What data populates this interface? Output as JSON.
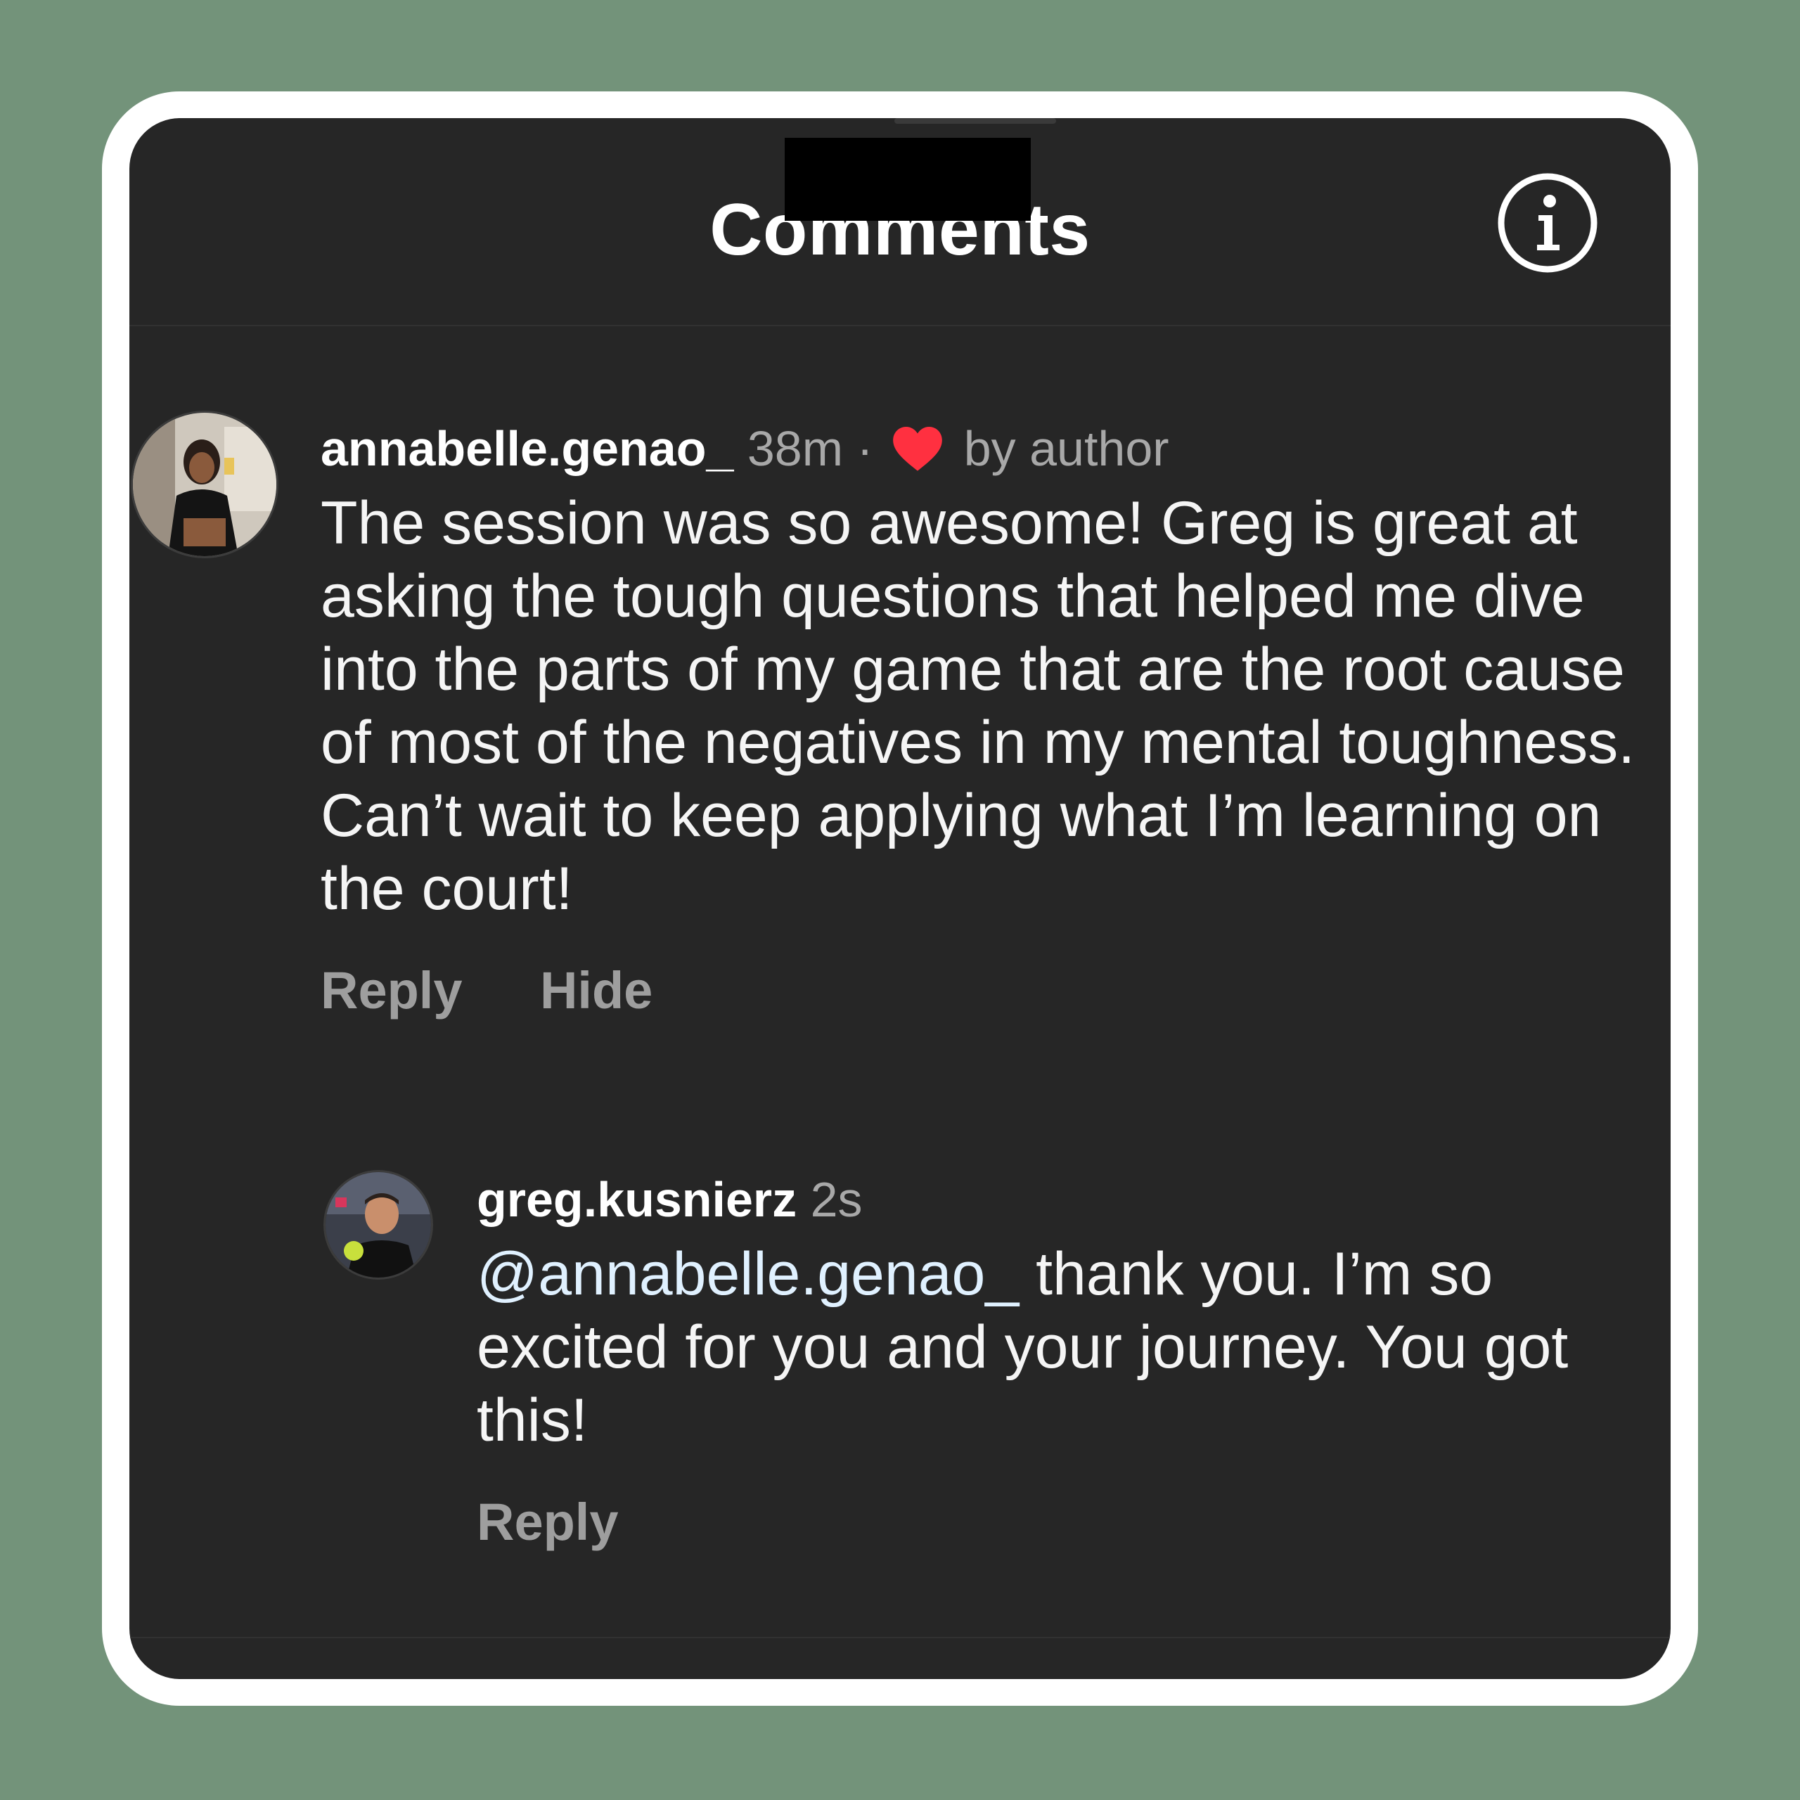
{
  "header": {
    "title": "Comments",
    "info_icon": "info-circle-icon"
  },
  "comments": [
    {
      "username": "annabelle.genao_",
      "time": "38m",
      "separator": "·",
      "liked_by_author_label": "by author",
      "liked_icon": "heart-icon",
      "heart_color": "#ff3040",
      "text": "The session was so awesome! Greg is great at asking the tough questions that helped me dive into the parts of my game that are the root cause of most of the negatives in my mental toughness.  Can’t wait to keep applying what I’m learning on the court!",
      "actions": {
        "reply": "Reply",
        "hide": "Hide"
      }
    }
  ],
  "replies": [
    {
      "username": "greg.kusnierz",
      "time": "2s",
      "mention": "@annabelle.genao_",
      "text": " thank you. I’m so excited for you and your journey. You got this!",
      "actions": {
        "reply": "Reply"
      }
    }
  ]
}
